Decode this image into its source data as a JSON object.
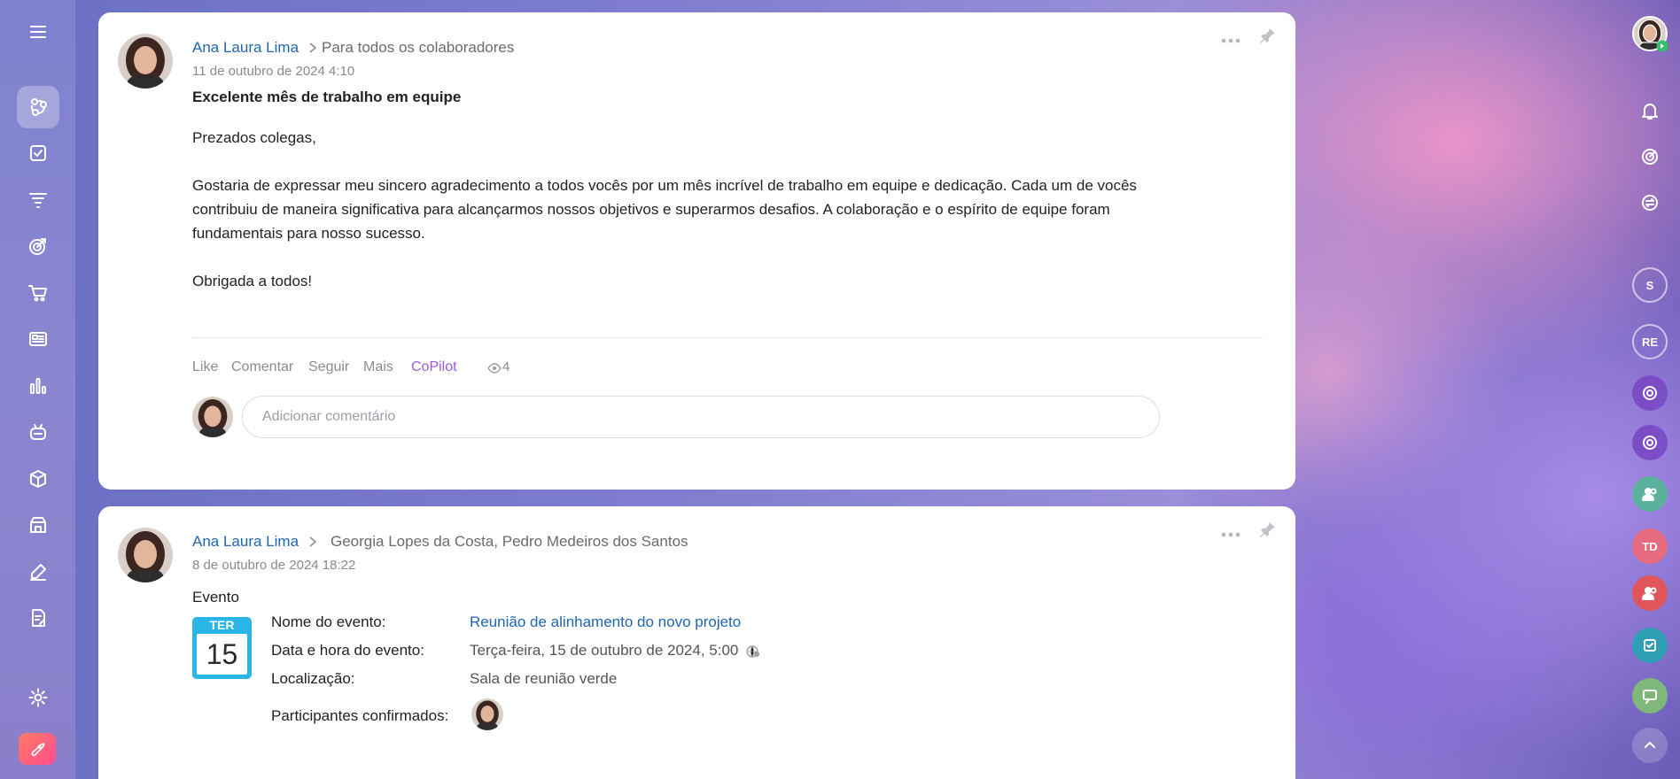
{
  "sidebar": {
    "items": [
      {
        "icon": "menu-icon"
      },
      {
        "icon": "feed-icon",
        "active": true
      },
      {
        "icon": "tasks-icon"
      },
      {
        "icon": "funnel-icon"
      },
      {
        "icon": "target-icon"
      },
      {
        "icon": "cart-icon"
      },
      {
        "icon": "news-icon"
      },
      {
        "icon": "analytics-icon"
      },
      {
        "icon": "bot-icon"
      },
      {
        "icon": "box-icon"
      },
      {
        "icon": "store-icon"
      },
      {
        "icon": "sign-icon"
      },
      {
        "icon": "document-icon"
      },
      {
        "icon": "settings-icon"
      },
      {
        "icon": "rocket-icon"
      }
    ]
  },
  "right_rail": {
    "items": [
      {
        "type": "avatar",
        "label": ""
      },
      {
        "type": "icon",
        "icon": "bell-icon"
      },
      {
        "type": "icon",
        "icon": "copilot-icon"
      },
      {
        "type": "icon",
        "icon": "transfer-icon"
      },
      {
        "type": "initials",
        "label": "S"
      },
      {
        "type": "initials",
        "label": "RE"
      },
      {
        "type": "icon",
        "icon": "copilot-chat-icon"
      },
      {
        "type": "icon",
        "icon": "copilot-chat-icon"
      },
      {
        "type": "icon",
        "icon": "group-icon"
      },
      {
        "type": "initials",
        "label": "TD"
      },
      {
        "type": "icon",
        "icon": "group-red-icon"
      },
      {
        "type": "icon",
        "icon": "task-chat-icon"
      },
      {
        "type": "icon",
        "icon": "chat-icon"
      },
      {
        "type": "icon",
        "icon": "chevron-up-icon"
      }
    ]
  },
  "posts": [
    {
      "author": "Ana Laura Lima",
      "destination": "Para todos os colaboradores",
      "date": "11 de outubro de 2024 4:10",
      "title": "Excelente mês de trabalho em equipe",
      "paragraphs": [
        "Prezados colegas,",
        "Gostaria de expressar meu sincero agradecimento a todos vocês por um mês incrível de trabalho em equipe e dedicação. Cada um de vocês contribuiu de maneira significativa para alcançarmos nossos objetivos e superarmos desafios. A colaboração e o espírito de equipe foram fundamentais para nosso sucesso.",
        "Obrigada a todos!"
      ],
      "actions": [
        "Like",
        "Comentar",
        "Seguir",
        "Mais",
        "CoPilot"
      ],
      "views": "4",
      "comment_placeholder": "Adicionar comentário"
    },
    {
      "author": "Ana Laura Lima",
      "destination": "Georgia Lopes da Costa, Pedro Medeiros dos Santos",
      "date": "8 de outubro de 2024 18:22",
      "title": "Evento",
      "calendar": {
        "dow": "TER",
        "day": "15"
      },
      "event": {
        "name_label": "Nome do evento:",
        "name_value": "Reunião de alinhamento do novo projeto",
        "datetime_label": "Data e hora do evento:",
        "datetime_value": "Terça-feira, 15 de outubro de 2024, 5:00",
        "location_label": "Localização:",
        "location_value": "Sala de reunião verde",
        "participants_label": "Participantes confirmados:"
      }
    }
  ],
  "colors": {
    "accent": "#2066b0",
    "highlight": "#e01e1e",
    "copilot": "#9a5bdb"
  }
}
